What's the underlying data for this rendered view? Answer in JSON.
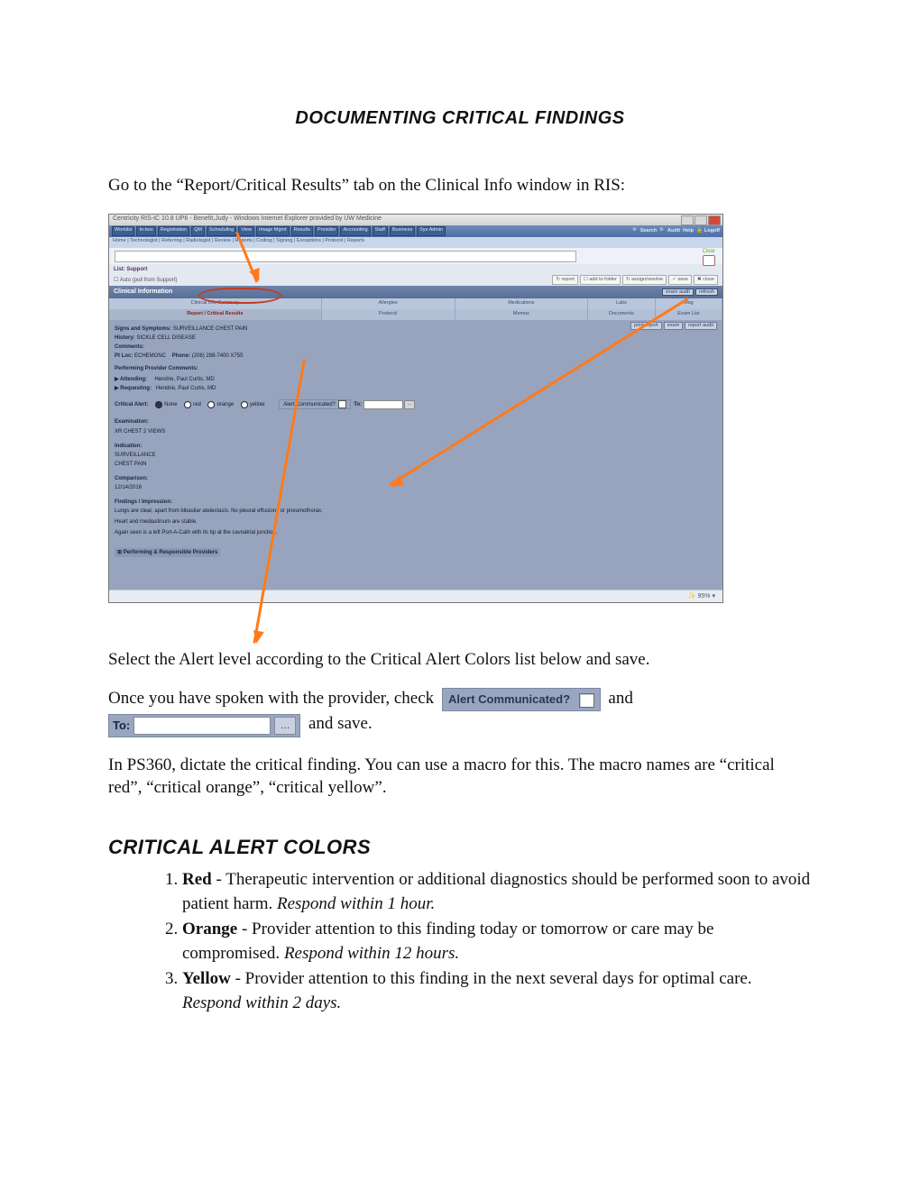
{
  "title": "DOCUMENTING CRITICAL FINDINGS",
  "p1": "Go to the “Report/Critical Results” tab on the Clinical Info window in RIS:",
  "p2": "Select the Alert level according to the Critical Alert Colors list below and save.",
  "p3a": "Once you have spoken with the provider, check ",
  "p3b": " and ",
  "p3c": " and save.",
  "p4": "In PS360, dictate the critical finding. You can use a macro for this. The macro names are “critical red”, “critical orange”, “critical yellow”.",
  "h2": "CRITICAL ALERT COLORS",
  "alerts": [
    {
      "name": "Red",
      "desc": " - Therapeutic intervention or additional diagnostics should be performed soon to avoid patient harm.  ",
      "resp": "Respond within 1 hour."
    },
    {
      "name": "Orange",
      "desc": " - Provider attention to this finding today or tomorrow or care may be compromised.  ",
      "resp": "Respond within 12 hours."
    },
    {
      "name": "Yellow",
      "desc": " - Provider attention to this finding in the next several days for optimal care.  ",
      "resp": "Respond within 2 days."
    }
  ],
  "chip_alert": "Alert Communicated?",
  "chip_to": "To:",
  "screenshot": {
    "window_title": "Centricity RIS-IC 10.8 UP6 - Benefit,Judy - Windows Internet Explorer provided by UW Medicine",
    "main_tabs": [
      "Worklist",
      "In-box",
      "Registration",
      "QM",
      "Scheduling",
      "View",
      "Image Mgmt",
      "Results",
      "Provider",
      "Accounting",
      "Staff",
      "Business",
      "Sys Admin"
    ],
    "top_right": [
      "Search",
      "Audit",
      "Help",
      "Logoff"
    ],
    "sub_tabs": "Home | Technologist | Referring | Radiologist | Review | Reports | Coding | Signing | Exceptions | Protocol | Reports",
    "toolbar_left": "List: Support",
    "toolbar_auto": "Auto (pull from Support)",
    "toolbar_buttons": [
      "↻ report",
      "☐ add to folder",
      "↻ assign/resolve",
      "✓ save",
      "✖ close"
    ],
    "section_title": "Clinical Information",
    "section_buttons": [
      "exam audit",
      "refresh"
    ],
    "row1": {
      "c1": "Clinical Info Summary",
      "c2": "Allergies",
      "c3": "Medications",
      "c4": "Labs",
      "c5": "Msg"
    },
    "row2": {
      "c1": "Report / Critical Results",
      "c2": "Protocol",
      "c3": "Memos",
      "c4": "Documents",
      "c5": "Exam List"
    },
    "right_buttons": [
      "print report",
      "exam",
      "report audit"
    ],
    "body": {
      "signs_label": "Signs and Symptoms:",
      "signs": "SURVEILLANCE CHEST PAIN",
      "history_label": "History:",
      "history": "SICKLE CELL DISEASE",
      "comments_label": "Comments:",
      "ptloc_label": "Pt Loc:",
      "ptloc": "ECHEMONC",
      "phone_label": "Phone:",
      "phone": "(206) 288-7400 X755",
      "perf_label": "Performing Provider Comments:",
      "attending_label": "▶ Attending:",
      "attending": "Hendrie, Paul Curtis, MD",
      "requesting_label": "▶ Requesting:",
      "requesting": "Hendrie, Paul Curtis, MD",
      "ca_label": "Critical Alert:",
      "ca_opts": [
        "None",
        "red",
        "orange",
        "yellow"
      ],
      "ac_label": "Alert Communicated?",
      "to_label": "To:",
      "exam_hdr": "Examination:",
      "exam": "XR CHEST 2 VIEWS",
      "ind_hdr": "Indication:",
      "ind1": "SURVEILLANCE",
      "ind2": "CHEST PAIN",
      "comp_hdr": "Comparison:",
      "comp": "12/14/2016",
      "find_hdr": "Findings / Impression:",
      "find1": "Lungs are clear, apart from bibasilar atelectasis. No pleural effusions or pneumothorax.",
      "find2": "Heart and mediastinum are stable.",
      "find3": "Again seen is a left Port-A-Cath with its tip at the cavoatrial junction.",
      "coll": "⊞ Performing & Responsible Providers"
    },
    "status": "✨ 95%   ▾",
    "clear_label": "Clear"
  }
}
